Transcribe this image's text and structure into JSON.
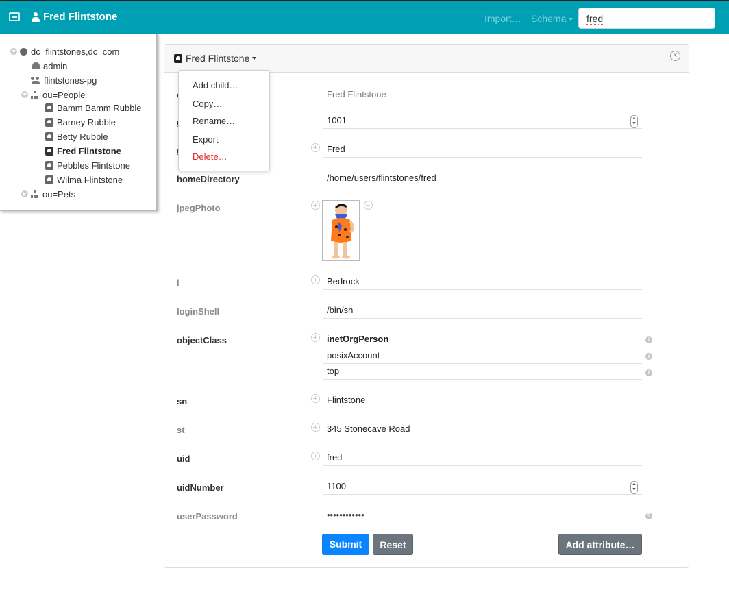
{
  "navbar": {
    "brand": "Fred Flintstone",
    "links": {
      "import": "Import…",
      "schema": "Schema"
    },
    "search_value": "fred"
  },
  "tree": {
    "root": "dc=flintstones,dc=com",
    "items": [
      {
        "label": "admin",
        "icon": "android-icon"
      },
      {
        "label": "flintstones-pg",
        "icon": "group-icon"
      },
      {
        "label": "ou=People",
        "icon": "org-icon",
        "expanded": true
      },
      {
        "label": "Bamm Bamm Rubble",
        "icon": "card-icon"
      },
      {
        "label": "Barney Rubble",
        "icon": "card-icon"
      },
      {
        "label": "Betty Rubble",
        "icon": "card-icon"
      },
      {
        "label": "Fred Flintstone",
        "icon": "card-icon",
        "selected": true
      },
      {
        "label": "Pebbles Flintstone",
        "icon": "card-icon"
      },
      {
        "label": "Wilma Flintstone",
        "icon": "card-icon"
      },
      {
        "label": "ou=Pets",
        "icon": "org-icon",
        "expanded": false
      }
    ]
  },
  "entry": {
    "title": "Fred Flintstone",
    "menu": [
      "Add child…",
      "Copy…",
      "Rename…",
      "Export",
      "Delete…"
    ],
    "attributes": {
      "cn": {
        "label": "cn",
        "value": "Fred Flintstone"
      },
      "gidNumber": {
        "label": "gidNumber",
        "value": "1001"
      },
      "givenName": {
        "label": "givenName",
        "value": "Fred"
      },
      "homeDirectory": {
        "label": "homeDirectory",
        "value": "/home/users/flintstones/fred"
      },
      "jpegPhoto": {
        "label": "jpegPhoto"
      },
      "l": {
        "label": "l",
        "value": "Bedrock"
      },
      "loginShell": {
        "label": "loginShell",
        "value": "/bin/sh"
      },
      "objectClass": {
        "label": "objectClass",
        "values": [
          "inetOrgPerson",
          "posixAccount",
          "top"
        ]
      },
      "sn": {
        "label": "sn",
        "value": "Flintstone"
      },
      "st": {
        "label": "st",
        "value": "345 Stonecave Road"
      },
      "uid": {
        "label": "uid",
        "value": "fred"
      },
      "uidNumber": {
        "label": "uidNumber",
        "value": "1100"
      },
      "userPassword": {
        "label": "userPassword",
        "value": "••••••••••••"
      }
    },
    "buttons": {
      "submit": "Submit",
      "reset": "Reset",
      "add_attribute": "Add attribute…"
    }
  },
  "colors": {
    "navbar": "#00a0b4",
    "primary": "#0a84ff",
    "secondary": "#6c757d",
    "danger": "#e8262d"
  }
}
